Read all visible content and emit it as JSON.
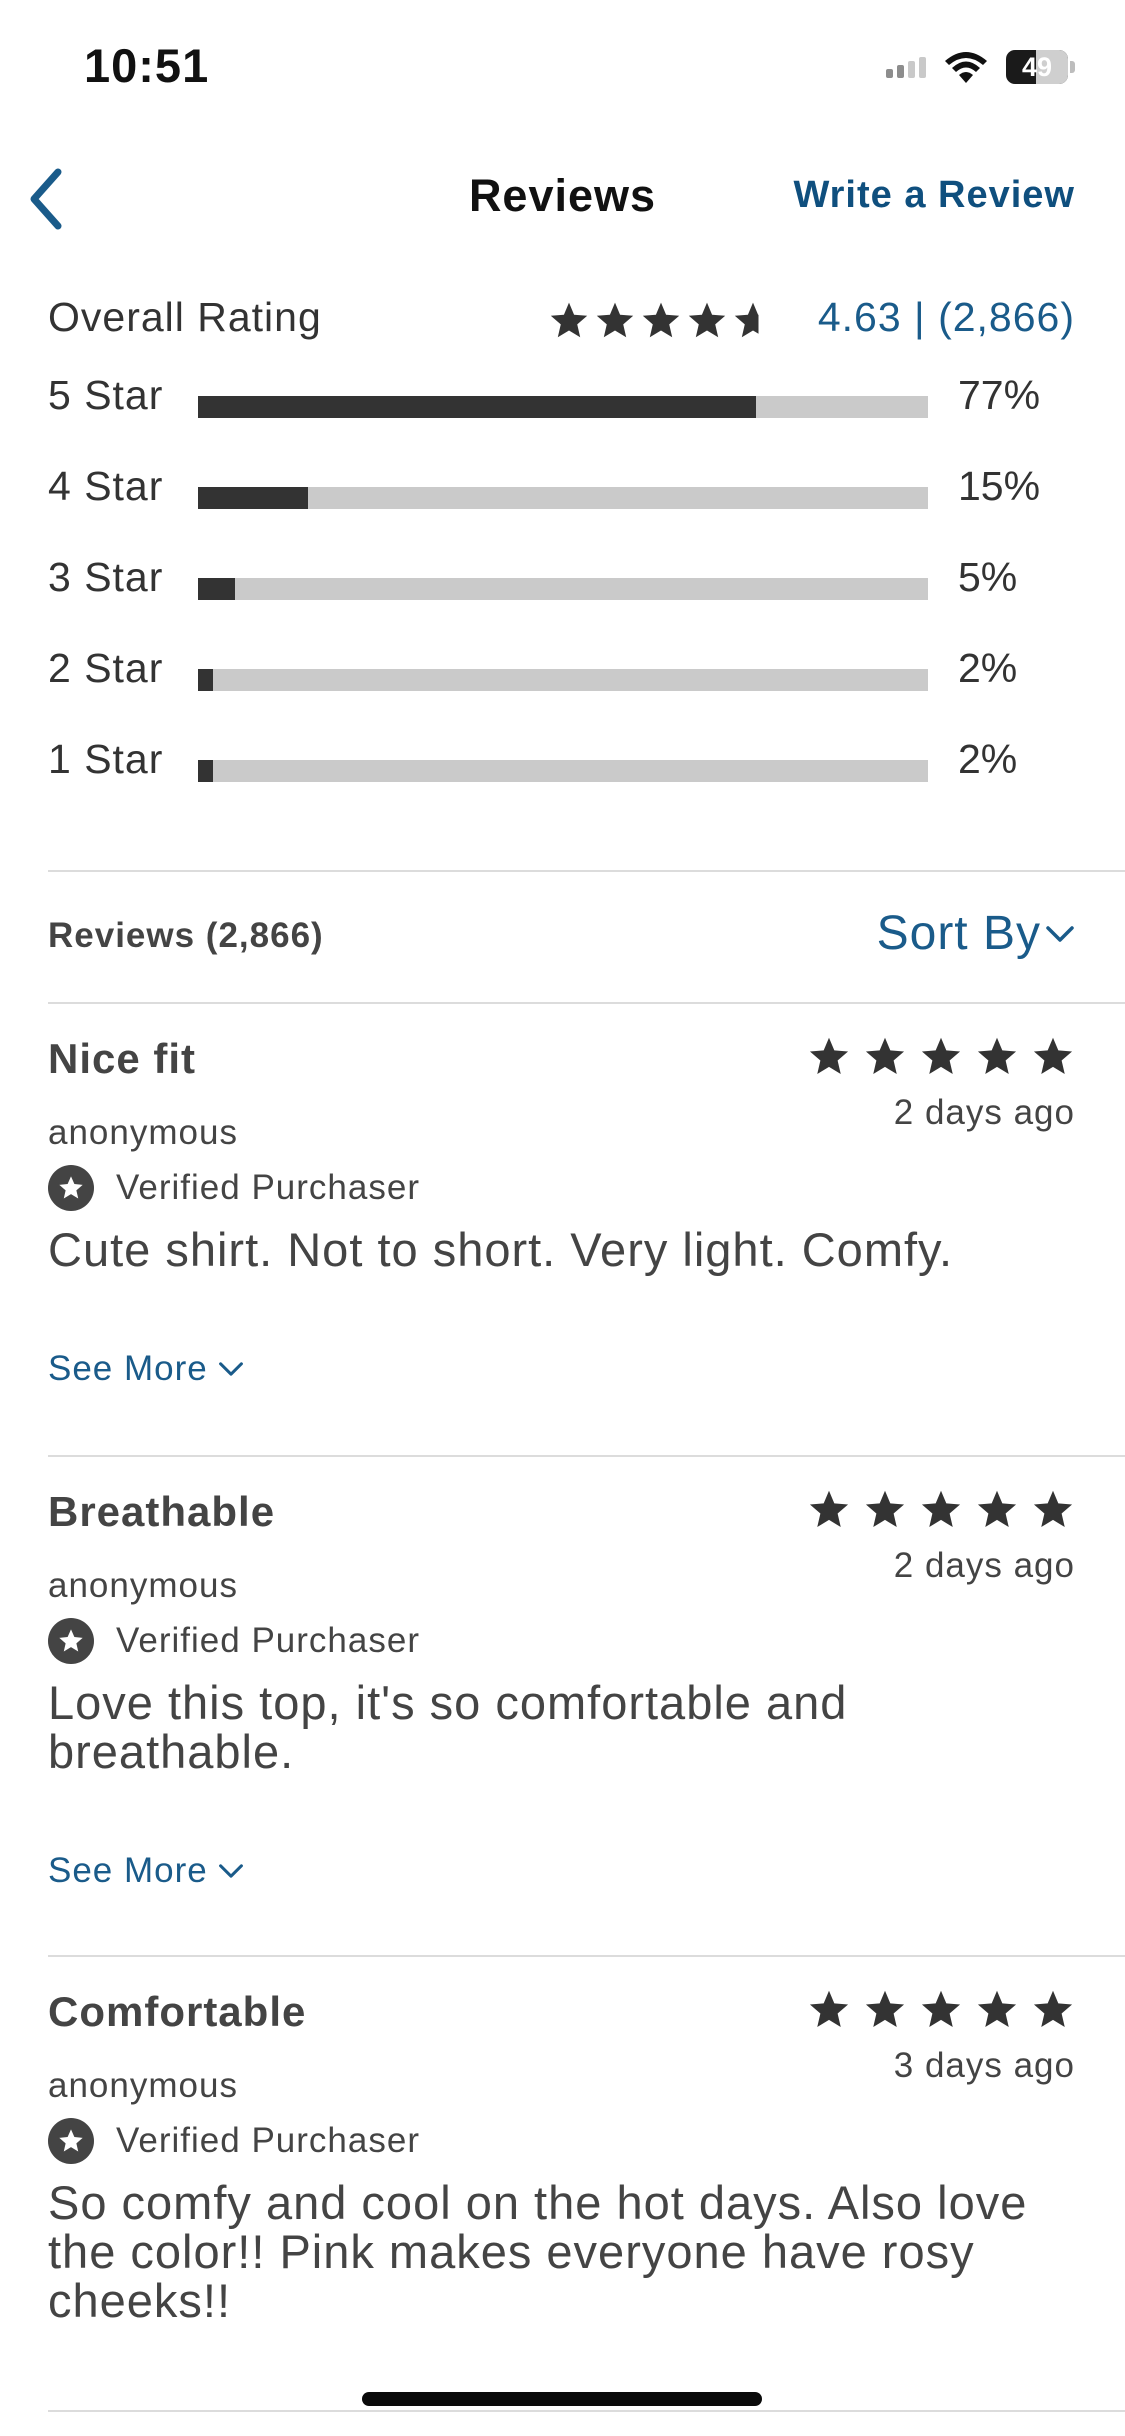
{
  "status_bar": {
    "time": "10:51",
    "battery": "49"
  },
  "nav": {
    "title": "Reviews",
    "write_review": "Write a Review"
  },
  "overall": {
    "label": "Overall Rating",
    "rating": 4.63,
    "value_text": "4.63 | (2,866)"
  },
  "breakdown": [
    {
      "label": "5 Star",
      "pct_text": "77%",
      "pct": 77
    },
    {
      "label": "4 Star",
      "pct_text": "15%",
      "pct": 15
    },
    {
      "label": "3 Star",
      "pct_text": "5%",
      "pct": 5
    },
    {
      "label": "2 Star",
      "pct_text": "2%",
      "pct": 2
    },
    {
      "label": "1 Star",
      "pct_text": "2%",
      "pct": 2
    }
  ],
  "list_header": {
    "count": "Reviews (2,866)",
    "sort_label": "Sort By"
  },
  "reviews": [
    {
      "title": "Nice fit",
      "rating": 5,
      "date": "2 days ago",
      "author": "anonymous",
      "verified": "Verified Purchaser",
      "body": "Cute shirt. Not to short. Very light. Comfy.",
      "see_more": "See More"
    },
    {
      "title": "Breathable",
      "rating": 5,
      "date": "2 days ago",
      "author": "anonymous",
      "verified": "Verified Purchaser",
      "body": "Love this top, it's so comfortable and breathable.",
      "see_more": "See More"
    },
    {
      "title": "Comfortable",
      "rating": 5,
      "date": "3 days ago",
      "author": "anonymous",
      "verified": "Verified Purchaser",
      "body": "So comfy and cool on the hot days.  Also love the color!! Pink makes everyone have rosy cheeks!!",
      "see_more": ""
    }
  ],
  "colors": {
    "accent": "#1a5b8a",
    "bar_fill": "#333333",
    "bar_track": "#cacaca"
  }
}
